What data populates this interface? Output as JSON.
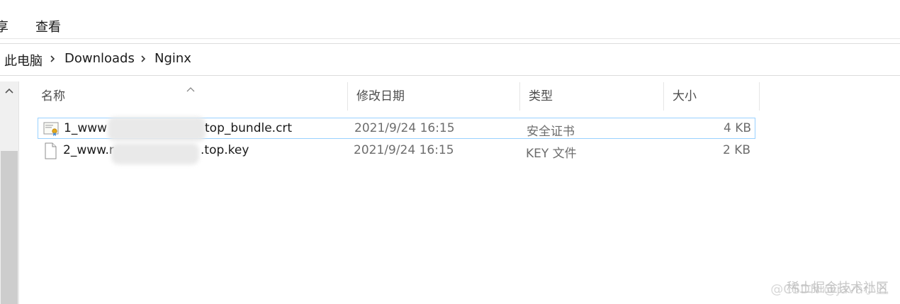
{
  "ribbon": {
    "tabs": [
      {
        "label": "享"
      },
      {
        "label": "查看"
      }
    ]
  },
  "address": {
    "crumbs": [
      "此电脑",
      "Downloads",
      "Nginx"
    ]
  },
  "columns": {
    "name": "名称",
    "date": "修改日期",
    "type": "类型",
    "size": "大小"
  },
  "files": [
    {
      "name_start": "1_www",
      "name_end": "top_bundle.crt",
      "date": "2021/9/24 16:15",
      "type": "安全证书",
      "size": "4 KB",
      "icon": "certificate-icon"
    },
    {
      "name_start": "2_www.r",
      "name_end": ".top.key",
      "date": "2021/9/24 16:15",
      "type": "KEY 文件",
      "size": "2 KB",
      "icon": "document-icon"
    }
  ],
  "watermark": {
    "line1": "稀土掘金技术社区",
    "line2": "@CSDN @java小丑"
  }
}
